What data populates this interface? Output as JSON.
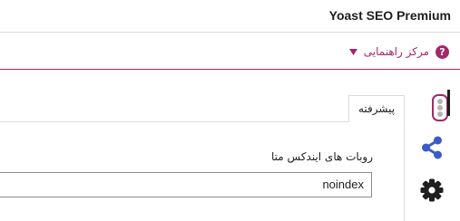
{
  "header": {
    "title": "Yoast SEO Premium"
  },
  "help": {
    "label": "مرکز راهنمایی",
    "icon": "question-circle-icon",
    "accent": "#a4286a"
  },
  "sidebar": {
    "items": [
      {
        "icon": "more-vertical-icon",
        "color": "#a4286a"
      },
      {
        "icon": "share-icon",
        "color": "#3a5bc7"
      },
      {
        "icon": "gear-icon",
        "color": "#1e1e1e",
        "active": true
      }
    ]
  },
  "panel": {
    "tab_label": "پیشرفته",
    "robots_meta": {
      "label": "روبات های ایندکس متا",
      "value": "noindex"
    }
  }
}
